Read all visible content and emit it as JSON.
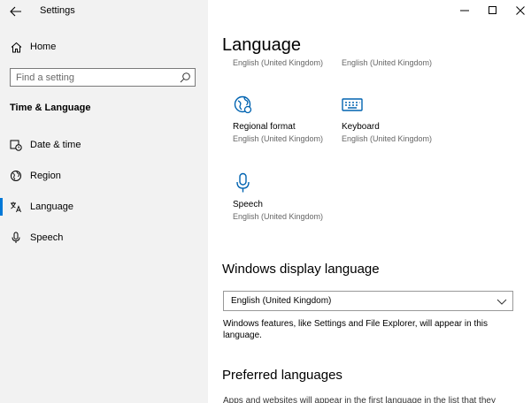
{
  "window": {
    "title": "Settings",
    "controls": {
      "minimize": "minimize-icon",
      "maximize": "maximize-icon",
      "close": "close-icon"
    }
  },
  "sidebar": {
    "home_label": "Home",
    "search_placeholder": "Find a setting",
    "section_title": "Time & Language",
    "items": [
      {
        "label": "Date & time",
        "icon": "date-time-icon"
      },
      {
        "label": "Region",
        "icon": "region-icon"
      },
      {
        "label": "Language",
        "icon": "language-icon",
        "active": true
      },
      {
        "label": "Speech",
        "icon": "microphone-icon"
      }
    ]
  },
  "main": {
    "title": "Language",
    "partial_items": [
      "English (United Kingdom)",
      "English (United Kingdom)"
    ],
    "tiles": [
      {
        "name": "Regional format",
        "sub": "English (United Kingdom)",
        "icon": "regional-format-icon"
      },
      {
        "name": "Keyboard",
        "sub": "English (United Kingdom)",
        "icon": "keyboard-icon"
      },
      {
        "name": "Speech",
        "sub": "English (United Kingdom)",
        "icon": "microphone-icon"
      }
    ],
    "display_language": {
      "heading": "Windows display language",
      "selected": "English (United Kingdom)",
      "description": "Windows features, like Settings and File Explorer, will appear in this language."
    },
    "preferred": {
      "heading": "Preferred languages",
      "text": "Apps and websites will appear in the first language in the list that they"
    }
  },
  "colors": {
    "accent": "#0078d7",
    "sidebar_bg": "#f2f2f2",
    "icon_blue": "#0063b1"
  }
}
